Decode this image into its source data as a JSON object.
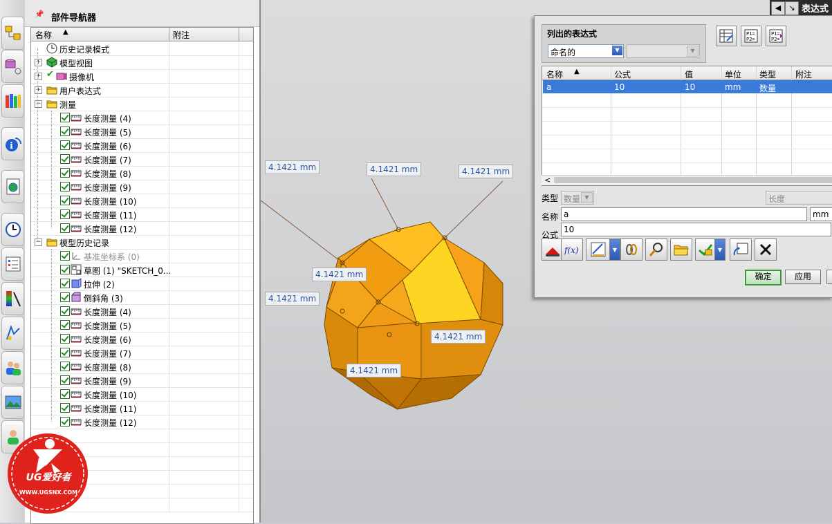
{
  "navigator": {
    "title": "部件导航器",
    "col_name": "名称",
    "col_note": "附注",
    "items": [
      {
        "label": "历史记录模式",
        "icon": "clock-icon"
      },
      {
        "label": "模型视图",
        "icon": "cube-view-icon"
      },
      {
        "label": "摄像机",
        "icon": "camera-icon"
      },
      {
        "label": "用户表达式",
        "icon": "folder-icon"
      },
      {
        "label": "测量",
        "icon": "folder-icon"
      },
      {
        "label": "长度测量 (4)"
      },
      {
        "label": "长度测量 (5)"
      },
      {
        "label": "长度测量 (6)"
      },
      {
        "label": "长度测量 (7)"
      },
      {
        "label": "长度测量 (8)"
      },
      {
        "label": "长度测量 (9)"
      },
      {
        "label": "长度测量 (10)"
      },
      {
        "label": "长度测量 (11)"
      },
      {
        "label": "长度测量 (12)"
      },
      {
        "label": "模型历史记录",
        "icon": "folder-icon"
      },
      {
        "label": "基准坐标系 (0)"
      },
      {
        "label": "草图 (1) \"SKETCH_0..."
      },
      {
        "label": "拉伸 (2)"
      },
      {
        "label": "倒斜角 (3)"
      },
      {
        "label": "长度测量 (4)"
      },
      {
        "label": "长度测量 (5)"
      },
      {
        "label": "长度测量 (6)"
      },
      {
        "label": "长度测量 (7)"
      },
      {
        "label": "长度测量 (8)"
      },
      {
        "label": "长度测量 (9)"
      },
      {
        "label": "长度测量 (10)"
      },
      {
        "label": "长度测量 (11)"
      },
      {
        "label": "长度测量 (12)"
      }
    ]
  },
  "viewport": {
    "dimension_label": "4.1421 mm"
  },
  "expression_dialog": {
    "title": "表达式",
    "listed_group_title": "列出的表达式",
    "filter_value": "命名的",
    "columns": [
      "名称",
      "公式",
      "值",
      "单位",
      "类型",
      "附注"
    ],
    "selected_row": {
      "name": "a",
      "formula": "10",
      "value": "10",
      "unit": "mm",
      "type": "数量"
    },
    "type_label": "类型",
    "type_value": "数量",
    "dimension_value": "长度",
    "name_label": "名称",
    "name_value": "a",
    "unit_value": "mm",
    "formula_label": "公式",
    "formula_value": "10",
    "ok_button": "确定",
    "apply_button": "应用"
  },
  "logo": {
    "brand": "UG爱好者",
    "url": "WWW.UGSNX.COM"
  },
  "colors": {
    "selection": "#3a7ad8",
    "dimension_text": "#2c56a8",
    "model_orange": "#f39a10",
    "model_yellow": "#ffd21a",
    "logo_red": "#e0221c"
  }
}
